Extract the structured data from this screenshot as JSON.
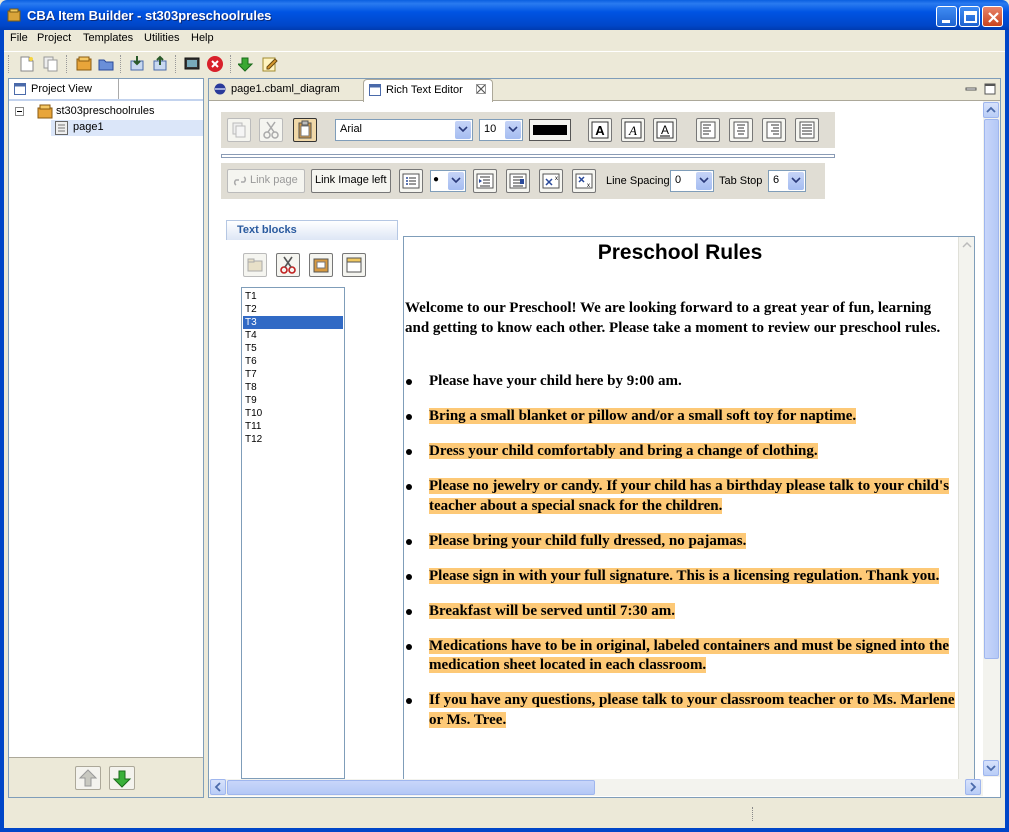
{
  "window": {
    "title": "CBA Item Builder - st303preschoolrules"
  },
  "menu": [
    "File",
    "Project",
    "Templates",
    "Utilities",
    "Help"
  ],
  "project_view": {
    "tab_label": "Project View",
    "tree": {
      "project": "st303preschoolrules",
      "page": "page1"
    }
  },
  "editor": {
    "tabs": [
      {
        "label": "page1.cbaml_diagram"
      },
      {
        "label": "Rich Text Editor"
      }
    ],
    "toolbar": {
      "font": "Arial",
      "font_size": "10",
      "color": "#000000",
      "link_page": "Link page",
      "link_image_left": "Link Image left",
      "bullet_value": "●",
      "line_spacing_label": "Line Spacing",
      "line_spacing_value": "0",
      "tab_stop_label": "Tab Stop",
      "tab_stop_value": "6"
    },
    "text_blocks": {
      "title": "Text blocks",
      "items": [
        "T1",
        "T2",
        "T3",
        "T4",
        "T5",
        "T6",
        "T7",
        "T8",
        "T9",
        "T10",
        "T11",
        "T12"
      ],
      "selected": "T3"
    },
    "document": {
      "title": "Preschool Rules",
      "intro": "Welcome to our Preschool! We are looking forward to a great year of fun, learning and getting to know each other. Please take a moment to review our preschool rules.",
      "highlight_color": "#fdc977",
      "rules": [
        {
          "text": "Please have your child here by 9:00 am.",
          "highlighted": false
        },
        {
          "text": "Bring a small blanket or pillow and/or a small soft toy for naptime.",
          "highlighted": true
        },
        {
          "text": "Dress your child comfortably and bring a change of clothing.",
          "highlighted": true
        },
        {
          "text": "Please no jewelry or candy. If your child has a birthday please talk to your child's teacher about a special snack for the children.",
          "highlighted": true
        },
        {
          "text": "Please bring your child fully dressed, no pajamas.",
          "highlighted": true
        },
        {
          "text": "Please sign in with your full signature. This is a licensing regulation. Thank you.",
          "highlighted": true
        },
        {
          "text": "Breakfast will be served until 7:30 am.",
          "highlighted": true
        },
        {
          "text": "Medications have to be in original, labeled containers and must be signed into the medication sheet located in each classroom.",
          "highlighted": true
        },
        {
          "text": "If you have any questions, please talk to your classroom teacher or to Ms. Marlene or Ms. Tree.",
          "highlighted": true
        }
      ]
    }
  }
}
